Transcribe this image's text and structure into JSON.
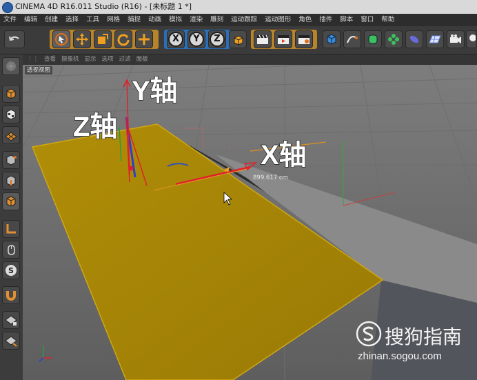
{
  "window": {
    "title": "CINEMA 4D R16.011 Studio (R16) - [未标题 1 *]"
  },
  "menu": [
    "文件",
    "编辑",
    "创建",
    "选择",
    "工具",
    "网格",
    "捕捉",
    "动画",
    "模拟",
    "渲染",
    "雕刻",
    "运动跟踪",
    "运动图形",
    "角色",
    "插件",
    "脚本",
    "窗口",
    "帮助"
  ],
  "toolbar": {
    "axis_x": "X",
    "axis_y": "Y",
    "axis_z": "Z"
  },
  "viewport": {
    "menu": [
      "查看",
      "摄像机",
      "显示",
      "选项",
      "过滤",
      "面板"
    ],
    "label": "透视视图",
    "measurement": "899.617 cm"
  },
  "annotations": {
    "y_axis": "Y轴",
    "z_axis": "Z轴",
    "x_axis": "X轴"
  },
  "watermark": {
    "brand": "搜狗指南",
    "url": "zhinan.sogou.com"
  },
  "colors": {
    "plane": "#a88a06",
    "x_axis": "#e0202a",
    "y_axis": "#2a3fd0",
    "z_axis": "#22a040",
    "toolbar_bg": "#3b3b3b"
  }
}
